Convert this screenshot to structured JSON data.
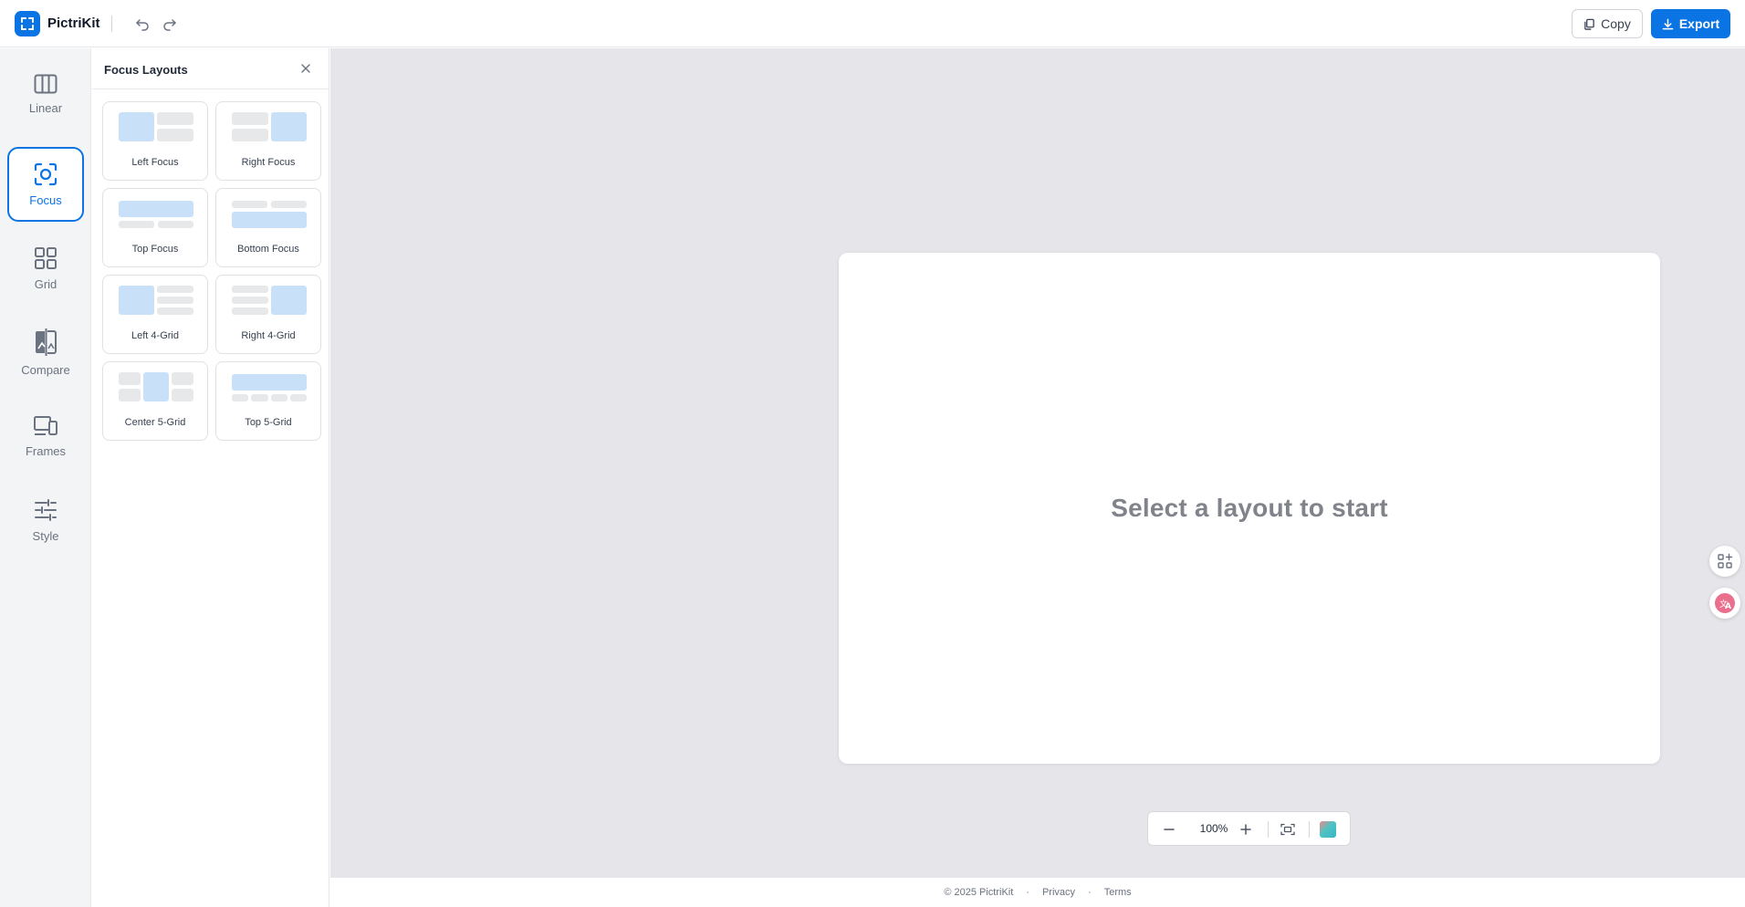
{
  "app": {
    "name": "PictriKit"
  },
  "header": {
    "copy_label": "Copy",
    "export_label": "Export"
  },
  "rail": {
    "items": [
      {
        "label": "Linear",
        "icon": "columns-icon"
      },
      {
        "label": "Focus",
        "icon": "focus-icon",
        "active": true
      },
      {
        "label": "Grid",
        "icon": "grid-icon"
      },
      {
        "label": "Compare",
        "icon": "compare-icon"
      },
      {
        "label": "Frames",
        "icon": "devices-icon"
      },
      {
        "label": "Style",
        "icon": "sliders-icon"
      }
    ]
  },
  "panel": {
    "title": "Focus Layouts",
    "layouts": [
      {
        "label": "Left Focus"
      },
      {
        "label": "Right Focus"
      },
      {
        "label": "Top Focus"
      },
      {
        "label": "Bottom Focus"
      },
      {
        "label": "Left 4-Grid"
      },
      {
        "label": "Right 4-Grid"
      },
      {
        "label": "Center 5-Grid"
      },
      {
        "label": "Top 5-Grid"
      }
    ]
  },
  "canvas": {
    "placeholder": "Select a layout to start"
  },
  "zoom": {
    "level": "100%"
  },
  "footer": {
    "copyright": "© 2025 PictriKit",
    "privacy": "Privacy",
    "terms": "Terms",
    "separator": "·"
  },
  "colors": {
    "accent": "#0b74e5",
    "thumb_focus": "#c8e1f8",
    "thumb_other": "#e7e8ea",
    "stage": "#e6e6ea"
  }
}
